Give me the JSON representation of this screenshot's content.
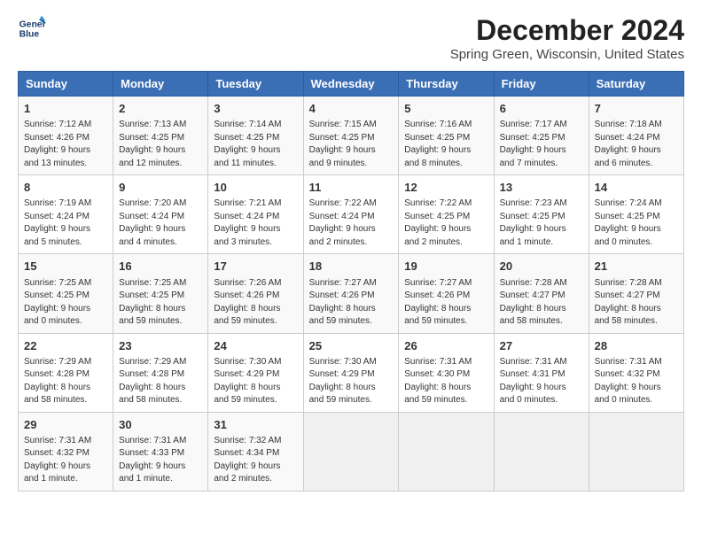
{
  "header": {
    "logo_line1": "General",
    "logo_line2": "Blue",
    "title": "December 2024",
    "subtitle": "Spring Green, Wisconsin, United States"
  },
  "columns": [
    "Sunday",
    "Monday",
    "Tuesday",
    "Wednesday",
    "Thursday",
    "Friday",
    "Saturday"
  ],
  "weeks": [
    [
      {
        "day": "1",
        "info": "Sunrise: 7:12 AM\nSunset: 4:26 PM\nDaylight: 9 hours\nand 13 minutes."
      },
      {
        "day": "2",
        "info": "Sunrise: 7:13 AM\nSunset: 4:25 PM\nDaylight: 9 hours\nand 12 minutes."
      },
      {
        "day": "3",
        "info": "Sunrise: 7:14 AM\nSunset: 4:25 PM\nDaylight: 9 hours\nand 11 minutes."
      },
      {
        "day": "4",
        "info": "Sunrise: 7:15 AM\nSunset: 4:25 PM\nDaylight: 9 hours\nand 9 minutes."
      },
      {
        "day": "5",
        "info": "Sunrise: 7:16 AM\nSunset: 4:25 PM\nDaylight: 9 hours\nand 8 minutes."
      },
      {
        "day": "6",
        "info": "Sunrise: 7:17 AM\nSunset: 4:25 PM\nDaylight: 9 hours\nand 7 minutes."
      },
      {
        "day": "7",
        "info": "Sunrise: 7:18 AM\nSunset: 4:24 PM\nDaylight: 9 hours\nand 6 minutes."
      }
    ],
    [
      {
        "day": "8",
        "info": "Sunrise: 7:19 AM\nSunset: 4:24 PM\nDaylight: 9 hours\nand 5 minutes."
      },
      {
        "day": "9",
        "info": "Sunrise: 7:20 AM\nSunset: 4:24 PM\nDaylight: 9 hours\nand 4 minutes."
      },
      {
        "day": "10",
        "info": "Sunrise: 7:21 AM\nSunset: 4:24 PM\nDaylight: 9 hours\nand 3 minutes."
      },
      {
        "day": "11",
        "info": "Sunrise: 7:22 AM\nSunset: 4:24 PM\nDaylight: 9 hours\nand 2 minutes."
      },
      {
        "day": "12",
        "info": "Sunrise: 7:22 AM\nSunset: 4:25 PM\nDaylight: 9 hours\nand 2 minutes."
      },
      {
        "day": "13",
        "info": "Sunrise: 7:23 AM\nSunset: 4:25 PM\nDaylight: 9 hours\nand 1 minute."
      },
      {
        "day": "14",
        "info": "Sunrise: 7:24 AM\nSunset: 4:25 PM\nDaylight: 9 hours\nand 0 minutes."
      }
    ],
    [
      {
        "day": "15",
        "info": "Sunrise: 7:25 AM\nSunset: 4:25 PM\nDaylight: 9 hours\nand 0 minutes."
      },
      {
        "day": "16",
        "info": "Sunrise: 7:25 AM\nSunset: 4:25 PM\nDaylight: 8 hours\nand 59 minutes."
      },
      {
        "day": "17",
        "info": "Sunrise: 7:26 AM\nSunset: 4:26 PM\nDaylight: 8 hours\nand 59 minutes."
      },
      {
        "day": "18",
        "info": "Sunrise: 7:27 AM\nSunset: 4:26 PM\nDaylight: 8 hours\nand 59 minutes."
      },
      {
        "day": "19",
        "info": "Sunrise: 7:27 AM\nSunset: 4:26 PM\nDaylight: 8 hours\nand 59 minutes."
      },
      {
        "day": "20",
        "info": "Sunrise: 7:28 AM\nSunset: 4:27 PM\nDaylight: 8 hours\nand 58 minutes."
      },
      {
        "day": "21",
        "info": "Sunrise: 7:28 AM\nSunset: 4:27 PM\nDaylight: 8 hours\nand 58 minutes."
      }
    ],
    [
      {
        "day": "22",
        "info": "Sunrise: 7:29 AM\nSunset: 4:28 PM\nDaylight: 8 hours\nand 58 minutes."
      },
      {
        "day": "23",
        "info": "Sunrise: 7:29 AM\nSunset: 4:28 PM\nDaylight: 8 hours\nand 58 minutes."
      },
      {
        "day": "24",
        "info": "Sunrise: 7:30 AM\nSunset: 4:29 PM\nDaylight: 8 hours\nand 59 minutes."
      },
      {
        "day": "25",
        "info": "Sunrise: 7:30 AM\nSunset: 4:29 PM\nDaylight: 8 hours\nand 59 minutes."
      },
      {
        "day": "26",
        "info": "Sunrise: 7:31 AM\nSunset: 4:30 PM\nDaylight: 8 hours\nand 59 minutes."
      },
      {
        "day": "27",
        "info": "Sunrise: 7:31 AM\nSunset: 4:31 PM\nDaylight: 9 hours\nand 0 minutes."
      },
      {
        "day": "28",
        "info": "Sunrise: 7:31 AM\nSunset: 4:32 PM\nDaylight: 9 hours\nand 0 minutes."
      }
    ],
    [
      {
        "day": "29",
        "info": "Sunrise: 7:31 AM\nSunset: 4:32 PM\nDaylight: 9 hours\nand 1 minute."
      },
      {
        "day": "30",
        "info": "Sunrise: 7:31 AM\nSunset: 4:33 PM\nDaylight: 9 hours\nand 1 minute."
      },
      {
        "day": "31",
        "info": "Sunrise: 7:32 AM\nSunset: 4:34 PM\nDaylight: 9 hours\nand 2 minutes."
      },
      null,
      null,
      null,
      null
    ]
  ]
}
